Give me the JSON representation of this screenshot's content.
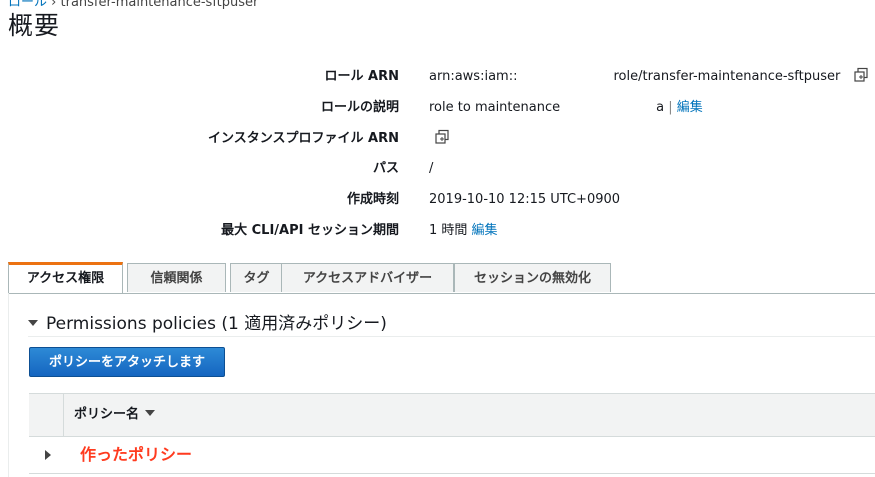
{
  "breadcrumb": {
    "prev": "ロール",
    "current": "transfer-maintenance-sftpuser"
  },
  "page": {
    "title": "概要"
  },
  "summary": {
    "role_arn": {
      "label": "ロール ARN",
      "value_prefix": "arn:aws:iam::",
      "value_suffix": "role/transfer-maintenance-sftpuser"
    },
    "description": {
      "label": "ロールの説明",
      "value": "role to maintenance",
      "trail": "a",
      "sep": "|",
      "edit": "編集"
    },
    "instance_profile": {
      "label": "インスタンスプロファイル ARN"
    },
    "path": {
      "label": "パス",
      "value": "/"
    },
    "created": {
      "label": "作成時刻",
      "value": "2019-10-10 12:15 UTC+0900"
    },
    "max_session": {
      "label": "最大 CLI/API セッション期間",
      "value": "1 時間",
      "edit": "編集"
    }
  },
  "tabs": [
    "アクセス権限",
    "信頼関係",
    "タグ",
    "アクセスアドバイザー",
    "セッションの無効化"
  ],
  "permissions": {
    "header": "Permissions policies (1 適用済みポリシー)",
    "attach_button": "ポリシーをアタッチします",
    "column_policy_name": "ポリシー名",
    "policies": [
      "作ったポリシー"
    ]
  },
  "colors": {
    "accent_tab": "#ec7211",
    "link": "#0073bb",
    "primary_button": "#1a6fc9",
    "annotation": "#ff3b1f"
  }
}
